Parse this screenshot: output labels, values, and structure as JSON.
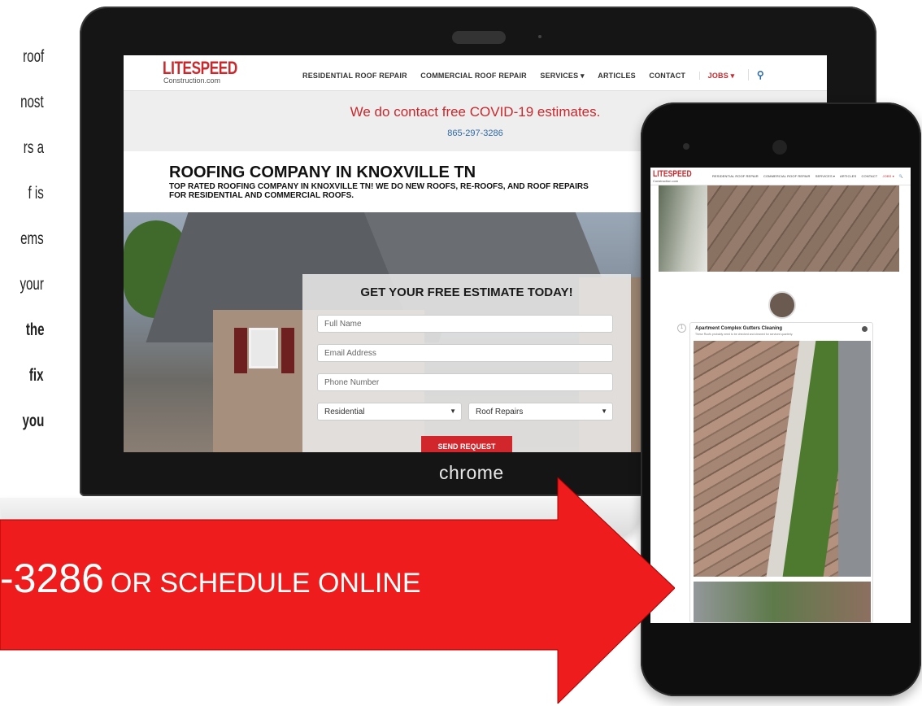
{
  "side_copy": [
    {
      "text": "roof",
      "bold": false
    },
    {
      "text": "nost",
      "bold": false
    },
    {
      "text": "rs a",
      "bold": false
    },
    {
      "text": "f is",
      "bold": false
    },
    {
      "text": "ems",
      "bold": false
    },
    {
      "text": "your",
      "bold": false
    },
    {
      "text": "the",
      "bold": true
    },
    {
      "text": "fix",
      "bold": true
    },
    {
      "text": "you",
      "bold": true
    }
  ],
  "laptop": {
    "brand": "chrome",
    "site": {
      "logo": "LITESPEED",
      "logo_sub": "Construction.com",
      "menu": {
        "residential": "RESIDENTIAL ROOF REPAIR",
        "commercial": "COMMERCIAL ROOF REPAIR",
        "services": "SERVICES ▾",
        "articles": "ARTICLES",
        "contact": "CONTACT",
        "jobs": "JOBS ▾",
        "search_icon": "search-icon"
      },
      "notice": "We do contact free COVID-19 estimates.",
      "phone": "865-297-3286",
      "headline": "ROOFING COMPANY IN KNOXVILLE TN",
      "subheadline": "TOP RATED ROOFING COMPANY IN KNOXVILLE TN! WE DO NEW ROOFS, RE-ROOFS, AND ROOF REPAIRS FOR RESIDENTIAL AND COMMERCIAL ROOFS.",
      "form": {
        "title": "GET YOUR FREE ESTIMATE TODAY!",
        "name_placeholder": "Full Name",
        "email_placeholder": "Email Address",
        "phone_placeholder": "Phone Number",
        "type_value": "Residential",
        "service_value": "Roof Repairs",
        "submit": "SEND REQUEST"
      }
    }
  },
  "phone": {
    "logo": "LITESPEED",
    "logo_sub": "Construction.com",
    "menu": {
      "residential": "RESIDENTIAL ROOF REPAIR",
      "commercial": "COMMERCIAL ROOF REPAIR",
      "services": "SERVICES ▾",
      "articles": "ARTICLES",
      "contact": "CONTACT",
      "jobs": "JOBS ▾",
      "search": "🔍"
    },
    "card": {
      "number": "1",
      "title": "Apartment Complex Gutters Cleaning",
      "subtitle": "These Roofs probably need to be checked and cleaned for serviced quarterly."
    }
  },
  "cta": {
    "number": "-3286",
    "text": "OR SCHEDULE ONLINE",
    "color": "#ee1c1c"
  }
}
